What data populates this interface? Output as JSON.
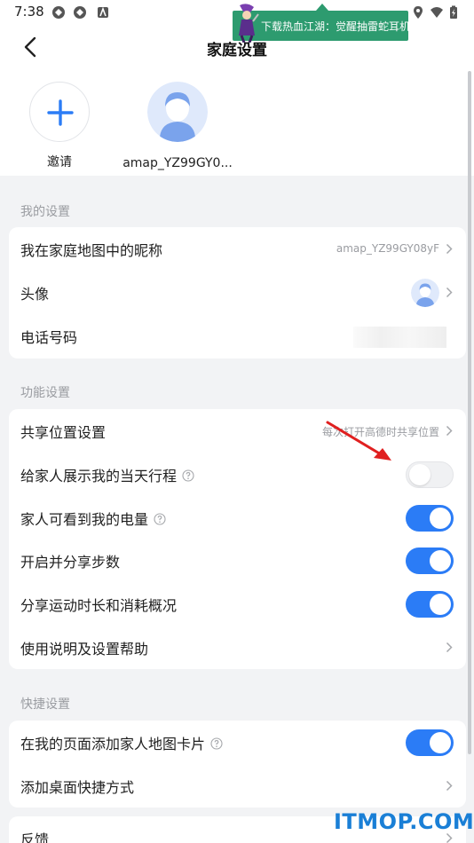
{
  "status_bar": {
    "time": "7:38"
  },
  "ad_banner": {
    "text": "下载热血江湖：觉醒抽雷蛇耳机"
  },
  "header": {
    "title": "家庭设置"
  },
  "members": [
    {
      "label": "邀请"
    },
    {
      "label": "amap_YZ99GY0..."
    }
  ],
  "my_settings": {
    "title": "我的设置",
    "rows": [
      {
        "label": "我在家庭地图中的昵称",
        "value": "amap_YZ99GY08yF"
      },
      {
        "label": "头像"
      },
      {
        "label": "电话号码"
      }
    ]
  },
  "function_settings": {
    "title": "功能设置",
    "rows": [
      {
        "label": "共享位置设置",
        "value": "每次打开高德时共享位置"
      },
      {
        "label": "给家人展示我的当天行程",
        "toggle": false
      },
      {
        "label": "家人可看到我的电量",
        "toggle": true
      },
      {
        "label": "开启并分享步数",
        "toggle": true
      },
      {
        "label": "分享运动时长和消耗概况",
        "toggle": true
      },
      {
        "label": "使用说明及设置帮助"
      }
    ]
  },
  "shortcut_settings": {
    "title": "快捷设置",
    "rows": [
      {
        "label": "在我的页面添加家人地图卡片",
        "toggle": true
      },
      {
        "label": "添加桌面快捷方式"
      }
    ]
  },
  "feedback": {
    "label": "反馈"
  },
  "watermark": "ITMOP.COM",
  "colors": {
    "accent": "#2b7cf6",
    "banner": "#2d9b6f",
    "watermark": "#1a7fd6",
    "annotation_arrow": "#e02020"
  }
}
